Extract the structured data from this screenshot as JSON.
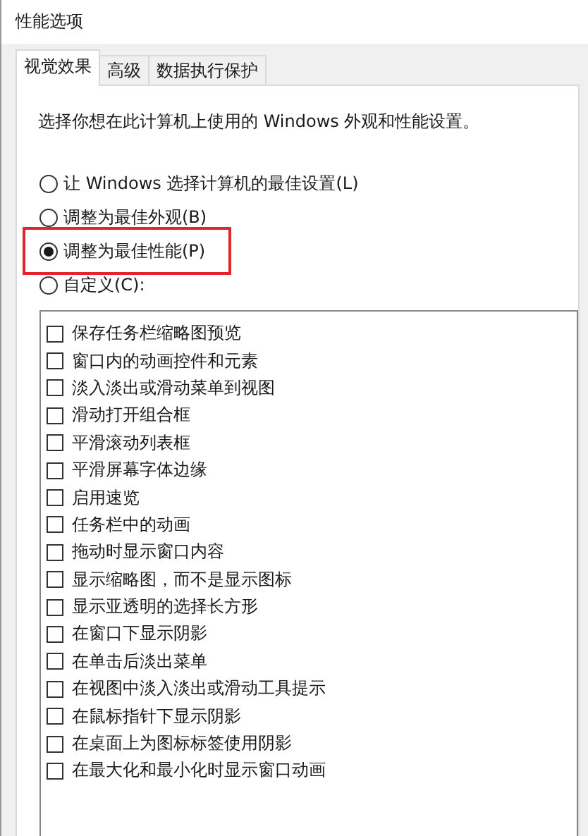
{
  "window": {
    "title": "性能选项"
  },
  "tabs": [
    {
      "label": "视觉效果",
      "selected": true
    },
    {
      "label": "高级",
      "selected": false
    },
    {
      "label": "数据执行保护",
      "selected": false
    }
  ],
  "description": "选择你想在此计算机上使用的 Windows 外观和性能设置。",
  "options": [
    {
      "label": "让 Windows 选择计算机的最佳设置(L)",
      "selected": false,
      "highlighted": false
    },
    {
      "label": "调整为最佳外观(B)",
      "selected": false,
      "highlighted": false
    },
    {
      "label": "调整为最佳性能(P)",
      "selected": true,
      "highlighted": true
    },
    {
      "label": "自定义(C):",
      "selected": false,
      "highlighted": false
    }
  ],
  "effects": [
    {
      "label": "保存任务栏缩略图预览",
      "checked": false
    },
    {
      "label": "窗口内的动画控件和元素",
      "checked": false
    },
    {
      "label": "淡入淡出或滑动菜单到视图",
      "checked": false
    },
    {
      "label": "滑动打开组合框",
      "checked": false
    },
    {
      "label": "平滑滚动列表框",
      "checked": false
    },
    {
      "label": "平滑屏幕字体边缘",
      "checked": false
    },
    {
      "label": "启用速览",
      "checked": false
    },
    {
      "label": "任务栏中的动画",
      "checked": false
    },
    {
      "label": "拖动时显示窗口内容",
      "checked": false
    },
    {
      "label": "显示缩略图，而不是显示图标",
      "checked": false
    },
    {
      "label": "显示亚透明的选择长方形",
      "checked": false
    },
    {
      "label": "在窗口下显示阴影",
      "checked": false
    },
    {
      "label": "在单击后淡出菜单",
      "checked": false
    },
    {
      "label": "在视图中淡入淡出或滑动工具提示",
      "checked": false
    },
    {
      "label": "在鼠标指针下显示阴影",
      "checked": false
    },
    {
      "label": "在桌面上为图标标签使用阴影",
      "checked": false
    },
    {
      "label": "在最大化和最小化时显示窗口动画",
      "checked": false
    }
  ]
}
